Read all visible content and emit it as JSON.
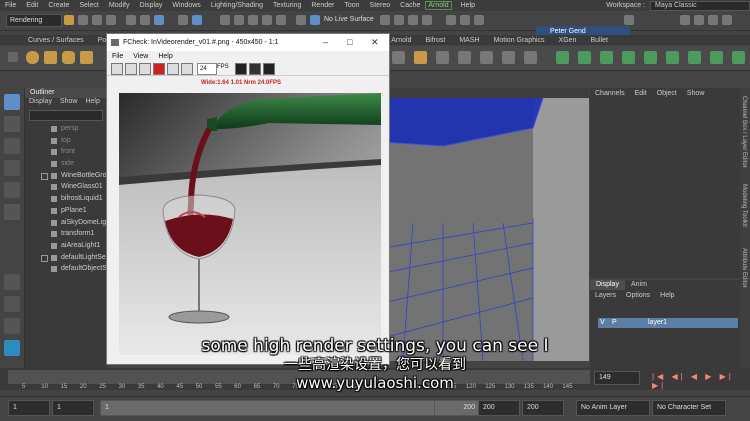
{
  "menubar": {
    "items": [
      "File",
      "Edit",
      "Create",
      "Select",
      "Modify",
      "Display",
      "Windows",
      "Lighting/Shading",
      "Texturing",
      "Render",
      "Toon",
      "Stereo",
      "Cache"
    ],
    "arnold": "Arnold",
    "help": "Help",
    "workspace_label": "Workspace :",
    "workspace_value": "Maya Classic"
  },
  "statusline": {
    "mode": "Rendering",
    "live_surface": "No Live Surface",
    "user": "Peter Gend"
  },
  "shelf": {
    "tabs_left": [
      "Curves / Surfaces",
      "Poly"
    ],
    "tabs_right": [
      "Arnold",
      "Bifrost",
      "MASH",
      "Motion Graphics",
      "XGen",
      "Bullet"
    ]
  },
  "outliner": {
    "title": "Outliner",
    "menu": [
      "Display",
      "Show",
      "Help"
    ],
    "items": [
      {
        "label": "persp",
        "dim": true
      },
      {
        "label": "top",
        "dim": true
      },
      {
        "label": "front",
        "dim": true
      },
      {
        "label": "side",
        "dim": true
      },
      {
        "label": "WineBottleGro",
        "dim": false
      },
      {
        "label": "WineGlass01",
        "dim": false
      },
      {
        "label": "bifrostLiquid1",
        "dim": false
      },
      {
        "label": "pPlane1",
        "dim": false
      },
      {
        "label": "aiSkyDomeLigh",
        "dim": false
      },
      {
        "label": "transform1",
        "dim": false
      },
      {
        "label": "aiAreaLight1",
        "dim": false
      },
      {
        "label": "defaultLightSe",
        "dim": false
      },
      {
        "label": "defaultObjectS",
        "dim": false
      }
    ]
  },
  "fcheck": {
    "title": "FCheck: InVideorender_v01.#.png - 450x450 - 1:1",
    "menu": [
      "File",
      "View",
      "Help"
    ],
    "fps_value": "24",
    "fps_label": "FPS",
    "status_text": "Wide:1.64  1.01  Nrm 24.0FPS"
  },
  "channelbox": {
    "menu": [
      "Channels",
      "Edit",
      "Object",
      "Show"
    ]
  },
  "layers": {
    "tabs": [
      "Display",
      "Anim"
    ],
    "menu": [
      "Layers",
      "Options",
      "Help"
    ],
    "v_flag": "V",
    "p_flag": "P",
    "layer_name": "layer1"
  },
  "sidetabs": [
    "Channel Box / Layer Editor",
    "Modeling Toolkit",
    "Attribute Editor"
  ],
  "timeline": {
    "ticks": [
      "5",
      "10",
      "15",
      "20",
      "25",
      "30",
      "35",
      "40",
      "45",
      "50",
      "55",
      "60",
      "65",
      "70",
      "75",
      "80",
      "85",
      "90",
      "95",
      "100",
      "105",
      "110",
      "115",
      "120",
      "125",
      "130",
      "135",
      "140",
      "145"
    ],
    "current_frame": "149"
  },
  "rangebar": {
    "start": "1",
    "playback_start": "1",
    "range_start": "1",
    "range_end": "200",
    "end_a": "200",
    "end_b": "200",
    "anim_layer": "No Anim Layer",
    "char_set": "No Character Set"
  },
  "subtitles": {
    "english": "some high render settings, you can see I",
    "chinese": "一些高渲染设置，您可以看到",
    "watermark": "www.yuyulaoshi.com"
  },
  "colors": {
    "accent": "#5d8fc9",
    "arnold": "#7fd07f",
    "layer_row": "#5c7fa5",
    "wine": "#6b0f1a",
    "bottle": "#1f5a2a"
  }
}
